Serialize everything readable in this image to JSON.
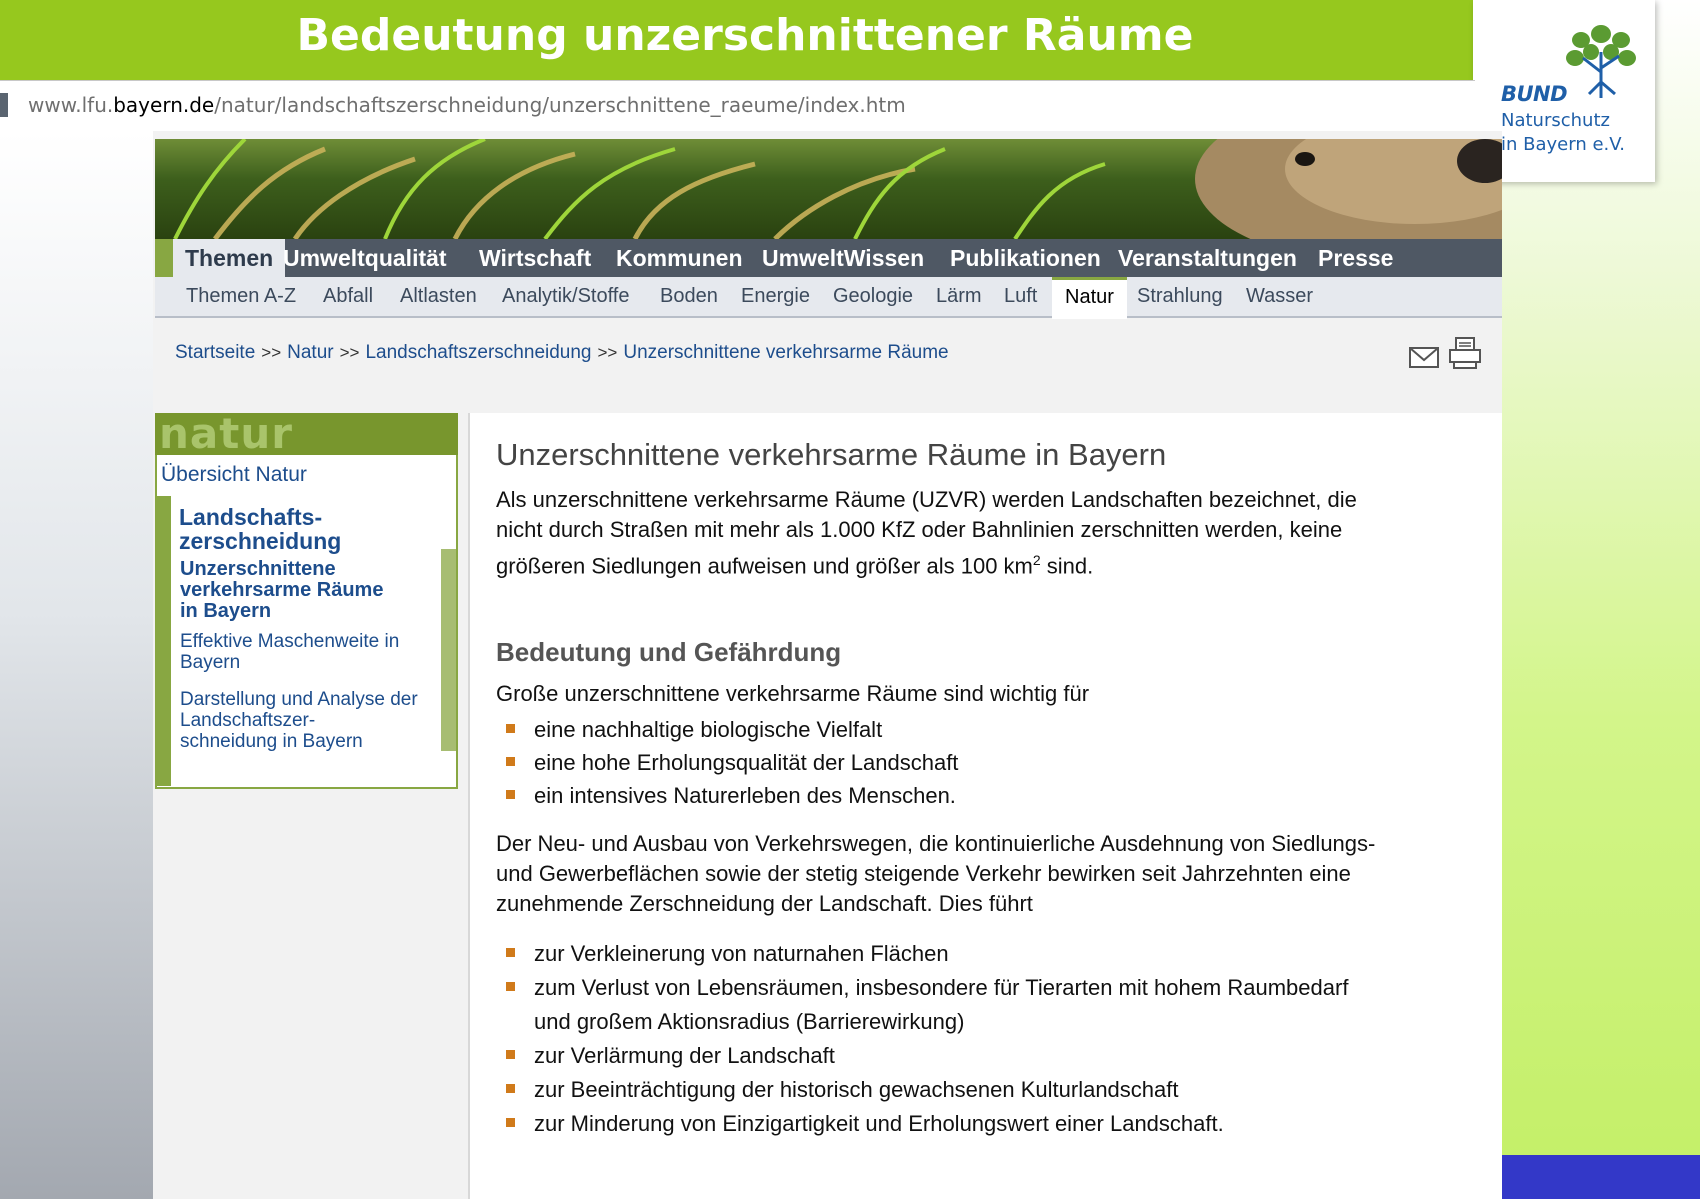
{
  "slide": {
    "title": "Bedeutung unzerschnittener Räume",
    "colors": {
      "title_bar": "#96c81e",
      "bottom_accent": "#3338c8"
    }
  },
  "logo": {
    "line1": "BUND",
    "line2": "Naturschutz",
    "line3": "in Bayern e.V.",
    "icon": "tree-icon"
  },
  "browser": {
    "url_prefix": "www.lfu.",
    "url_domain": "bayern.de",
    "url_path": "/natur/landschaftszerschneidung/unzerschnittene_raeume/index.htm"
  },
  "nav": {
    "main": [
      "Themen",
      "Umweltqualität",
      "Wirtschaft",
      "Kommunen",
      "UmweltWissen",
      "Publikationen",
      "Veranstaltungen",
      "Presse"
    ],
    "sub": [
      "Themen A-Z",
      "Abfall",
      "Altlasten",
      "Analytik/Stoffe",
      "Boden",
      "Energie",
      "Geologie",
      "Lärm",
      "Luft",
      "Natur",
      "Strahlung",
      "Wasser"
    ],
    "active_main": "Themen",
    "active_sub": "Natur"
  },
  "breadcrumb": {
    "items": [
      "Startseite",
      "Natur",
      "Landschaftszerschneidung",
      "Unzerschnittene verkehrsarme Räume"
    ],
    "separator": ">>"
  },
  "icons": {
    "mail": "mail-icon",
    "print": "print-icon"
  },
  "sidebar": {
    "header": "natur",
    "overview": "Übersicht Natur",
    "section_line1": "Landschafts-",
    "section_line2": "zerschneidung",
    "current_line1": "Unzerschnittene",
    "current_line2": "verkehrsarme Räume",
    "current_line3": "in Bayern",
    "link1_line1": "Effektive Maschenweite in",
    "link1_line2": "Bayern",
    "link2_line1": "Darstellung und Analyse der",
    "link2_line2": "Landschaftszer-",
    "link2_line3": "schneidung in Bayern"
  },
  "content": {
    "heading": "Unzerschnittene verkehrsarme Räume in Bayern",
    "intro_line1": "Als unzerschnittene verkehrsarme Räume (UZVR) werden Landschaften bezeichnet, die",
    "intro_line2": "nicht durch Straßen mit mehr als 1.000 KfZ oder Bahnlinien zerschnitten werden, keine",
    "intro_line3a": "größeren Siedlungen aufweisen und größer als 100 km",
    "intro_sup": "2",
    "intro_line3b": " sind.",
    "subheading": "Bedeutung und Gefährdung",
    "para1": "Große unzerschnittene verkehrsarme Räume sind wichtig für",
    "list1": [
      "eine nachhaltige biologische Vielfalt",
      "eine hohe Erholungsqualität der Landschaft",
      "ein intensives Naturerleben des Menschen."
    ],
    "para2_line1": "Der Neu- und Ausbau von Verkehrswegen, die kontinuierliche Ausdehnung von Siedlungs-",
    "para2_line2": "und Gewerbeflächen sowie der stetig steigende Verkehr bewirken seit Jahrzehnten eine",
    "para2_line3": "zunehmende Zerschneidung der Landschaft. Dies führt",
    "list2": [
      "zur Verkleinerung von naturnahen Flächen",
      "zum Verlust von Lebensräumen, insbesondere für Tierarten mit hohem Raumbedarf",
      "zur Verlärmung der Landschaft",
      "zur Beeinträchtigung der historisch gewachsenen Kulturlandschaft",
      "zur Minderung von Einzigartigkeit und Erholungswert einer Landschaft."
    ],
    "list2_item2_cont": "und großem Aktionsradius (Barrierewirkung)"
  }
}
